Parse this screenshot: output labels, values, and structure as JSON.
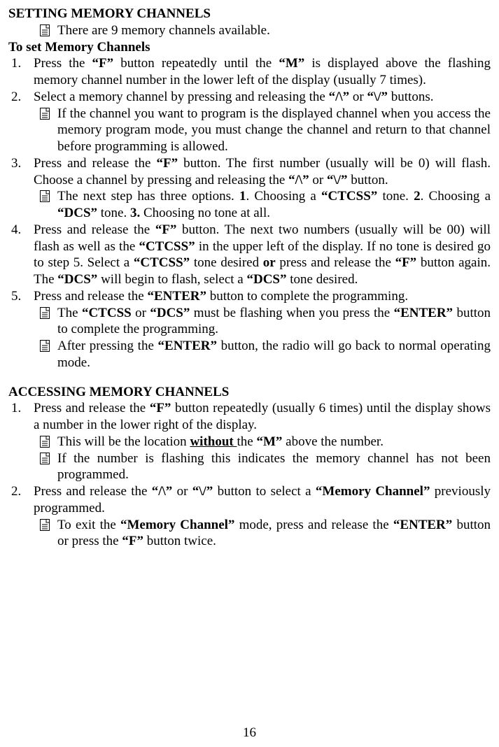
{
  "section1": {
    "title": "SETTING MEMORY CHANNELS",
    "note0": "There are 9 memory channels available.",
    "subtitle": "To set Memory Channels",
    "item1_num": "1.",
    "item1_text_a": "Press the ",
    "item1_b1": "“F”",
    "item1_text_b": " button repeatedly until the ",
    "item1_b2": "“M”",
    "item1_text_c": " is displayed above the flashing memory channel number in the lower left of the display (usually 7 times).",
    "item2_num": "2.",
    "item2_text_a": "Select a memory channel by pressing and releasing the ",
    "item2_b1": "“/\\”",
    "item2_text_b": " or ",
    "item2_b2": "“\\/”",
    "item2_text_c": "  buttons.",
    "note2_text": "If the channel you want to program is the displayed channel when you access the memory program mode, you must change the channel and return to that channel before programming is allowed.",
    "item3_num": "3.",
    "item3_text_a": "Press and release the ",
    "item3_b1": "“F”",
    "item3_text_b": " button. The first number (usually will be 0) will flash. Choose a channel by pressing and releasing the ",
    "item3_b2": "“/\\”",
    "item3_text_c": " or ",
    "item3_b3": "“\\/”",
    "item3_text_d": " button.",
    "note3_text_a": "The next step has three options. ",
    "note3_b1": "1",
    "note3_text_b": ". Choosing a ",
    "note3_b2": "“CTCSS”",
    "note3_text_c": " tone. ",
    "note3_b3": "2",
    "note3_text_d": ". Choosing a ",
    "note3_b4": "“DCS”",
    "note3_text_e": " tone. ",
    "note3_b5": "3.",
    "note3_text_f": " Choosing no tone at all.",
    "item4_num": "4.",
    "item4_text_a": "Press and release the ",
    "item4_b1": "“F”",
    "item4_text_b": " button. The next two numbers (usually will be 00) will flash as well as the ",
    "item4_b2": "“CTCSS”",
    "item4_text_c": " in the upper left of the display. If no tone is desired go to step 5. Select a ",
    "item4_b3": "“CTCSS”",
    "item4_text_d": " tone desired ",
    "item4_b4": "or",
    "item4_text_e": " press and release the ",
    "item4_b5": "“F”",
    "item4_text_f": " button again. The ",
    "item4_b6": "“DCS”",
    "item4_text_g": " will begin to flash, select a ",
    "item4_b7": "“DCS”",
    "item4_text_h": " tone desired.",
    "item5_num": " 5.",
    "item5_text_a": "Press and release the ",
    "item5_b1": "“ENTER”",
    "item5_text_b": " button to complete the programming.",
    "note5a_text_a": "The ",
    "note5a_b1": "“CTCSS",
    "note5a_text_b": " or ",
    "note5a_b2": "“DCS”",
    "note5a_text_c": " must be flashing when you press the ",
    "note5a_b3": "“ENTER”",
    "note5a_text_d": " button to complete the programming.",
    "note5b_text_a": "After pressing the ",
    "note5b_b1": "“ENTER”",
    "note5b_text_b": " button, the radio will go back to normal operating mode."
  },
  "section2": {
    "title": "ACCESSING MEMORY CHANNELS",
    "item1_num": "1.",
    "item1_text_a": "Press and release the ",
    "item1_b1": "“F”",
    "item1_text_b": " button repeatedly (usually 6 times) until the display shows a number in the lower right of the display.",
    "note1a_text_a": "This will be the location ",
    "note1a_u1": "without ",
    "note1a_text_b": "the ",
    "note1a_b1": "“M”",
    "note1a_text_c": " above the number.",
    "note1b_text": "If the number is flashing this indicates the memory channel has not been programmed.",
    "item2_num": "2.",
    "item2_text_a": "Press and release the ",
    "item2_b1": "“/\\”",
    "item2_text_b": " or ",
    "item2_b2": "“\\/”",
    "item2_text_c": " button to select a ",
    "item2_b3": "“Memory Channel”",
    "item2_text_d": " previously programmed.",
    "note2_text_a": "To exit the ",
    "note2_b1": "“Memory Channel”",
    "note2_text_b": " mode, press and release the ",
    "note2_b2": "“ENTER”",
    "note2_text_c": " button or press the ",
    "note2_b3": "“F”",
    "note2_text_d": " button twice."
  },
  "page_number": "16"
}
